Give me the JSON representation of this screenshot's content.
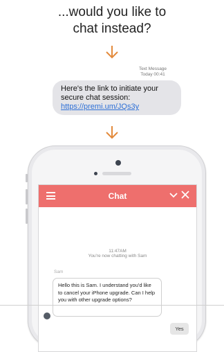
{
  "headline": {
    "line1": "...would you like to",
    "line2": "chat instead?"
  },
  "sms": {
    "label": "Text Message",
    "time": "Today 00:41",
    "text_prefix": "Here's the link to initiate your secure chat session: ",
    "link_text": "https://premi.um/JQs3y"
  },
  "chat": {
    "title": "Chat",
    "system_time": "11:47AM",
    "system_message": "You're now chatting with Sam",
    "agent_name": "Sam",
    "agent_message": "Hello this is Sam. I understand you'd like to cancel your iPhone upgrade. Can I help you with other upgrade options?",
    "user_reply": "Yes"
  },
  "icons": {
    "menu": "hamburger-icon",
    "minimize": "chevron-down-icon",
    "close": "close-icon",
    "arrow": "arrow-down-icon"
  },
  "colors": {
    "accent_arrow": "#e38a3b",
    "chat_header": "#ee6f6d",
    "link": "#2d6fd6"
  }
}
